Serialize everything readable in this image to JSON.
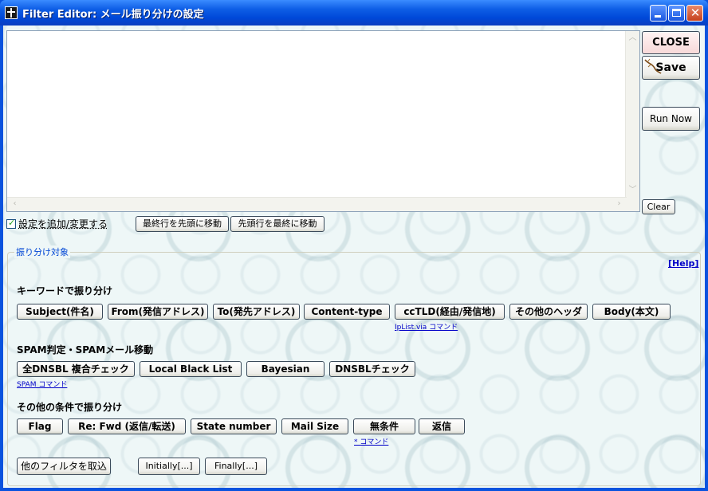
{
  "window": {
    "title": "Filter Editor: メール振り分けの設定"
  },
  "side_buttons": {
    "close": "CLOSE",
    "save": "Save",
    "run_now": "Run Now",
    "clear": "Clear"
  },
  "editor": {
    "value": ""
  },
  "options": {
    "add_change_label": "設定を追加/変更する",
    "add_change_checked": true,
    "move_last_to_top": "最終行を先頭に移動",
    "move_top_to_last": "先頭行を最終に移動"
  },
  "group": {
    "title": "振り分け対象",
    "help": "[Help]"
  },
  "keyword": {
    "heading": "キーワードで振り分け",
    "buttons": [
      "Subject(件名)",
      "From(発信アドレス)",
      "To(発先アドレス)",
      "Content-type",
      "ccTLD(経由/発信地)",
      "その他のヘッダ",
      "Body(本文)"
    ],
    "iplist_link": "IpList.via コマンド"
  },
  "spam": {
    "heading": "SPAM判定・SPAMメール移動",
    "buttons": [
      "全DNSBL 複合チェック",
      "Local Black List",
      "Bayesian",
      "DNSBLチェック"
    ],
    "spam_link": "SPAM コマンド"
  },
  "other": {
    "heading": "その他の条件で振り分け",
    "buttons": [
      "Flag",
      "Re: Fwd (返信/転送)",
      "State number",
      "Mail Size",
      "無条件",
      "返信"
    ],
    "cmd_link": "* コマンド"
  },
  "bottom": {
    "import": "他のフィルタを取込",
    "initially": "Initially[...]",
    "finally": "Finally[...]"
  }
}
